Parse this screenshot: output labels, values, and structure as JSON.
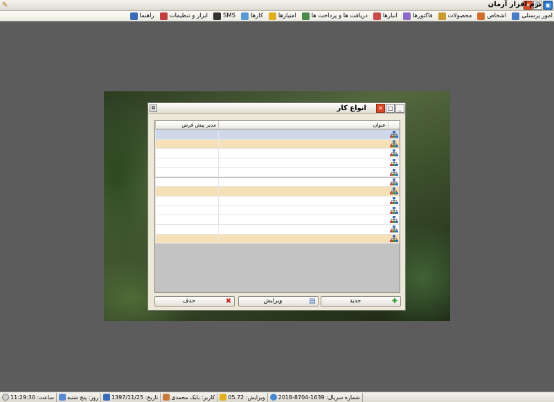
{
  "app": {
    "title": "نرم افزار آرمان"
  },
  "menu": [
    {
      "label": "امور پرسنلی",
      "icon": "personnel-icon",
      "color": "#4a7ac8"
    },
    {
      "label": "اشخاص",
      "icon": "people-icon",
      "color": "#d07030"
    },
    {
      "label": "محصولات",
      "icon": "products-icon",
      "color": "#c89a30"
    },
    {
      "label": "فاکتورها",
      "icon": "invoices-icon",
      "color": "#8a6ac8"
    },
    {
      "label": "انبارها",
      "icon": "warehouse-icon",
      "color": "#c84a4a"
    },
    {
      "label": "دریافت ها و پرداخت ها",
      "icon": "payments-icon",
      "color": "#4a8a4a"
    },
    {
      "label": "امتیازها",
      "icon": "star-icon",
      "color": "#e0b020"
    },
    {
      "label": "کارها",
      "icon": "tasks-icon",
      "color": "#5a9ad0"
    },
    {
      "label": "SMS",
      "icon": "sms-icon",
      "color": "#333333"
    },
    {
      "label": "ابزار و تنظیمات",
      "icon": "tools-icon",
      "color": "#c04040"
    },
    {
      "label": "راهنما",
      "icon": "help-icon",
      "color": "#3a6ab8"
    }
  ],
  "dialog": {
    "title": "انواع کار",
    "columns": {
      "title": "عنوان",
      "default_manager": "مدیر پیش فرض"
    },
    "rows": [
      {
        "state": "selected"
      },
      {
        "state": "highlight"
      },
      {
        "state": "normal"
      },
      {
        "state": "normal"
      },
      {
        "state": "normal"
      },
      {
        "state": "normal"
      },
      {
        "state": "highlight"
      },
      {
        "state": "normal"
      },
      {
        "state": "normal"
      },
      {
        "state": "normal"
      },
      {
        "state": "normal"
      },
      {
        "state": "highlight"
      }
    ],
    "buttons": {
      "new": "جدید",
      "edit": "ویرایش",
      "delete": "حذف"
    }
  },
  "status": {
    "serial": "شماره سریال: 1639-8704-2018",
    "version": "ویرایش: 05.72",
    "user": "کاربر: بابک محمدی",
    "date": "تاریخ: 1397/11/25",
    "day": "روز: پنج شنبه",
    "time": "ساعت: 11:29:30"
  },
  "colors": {
    "accent": "#2a7ad0",
    "row_highlight": "#f6e0b8",
    "row_selected": "#cfd8ea"
  }
}
